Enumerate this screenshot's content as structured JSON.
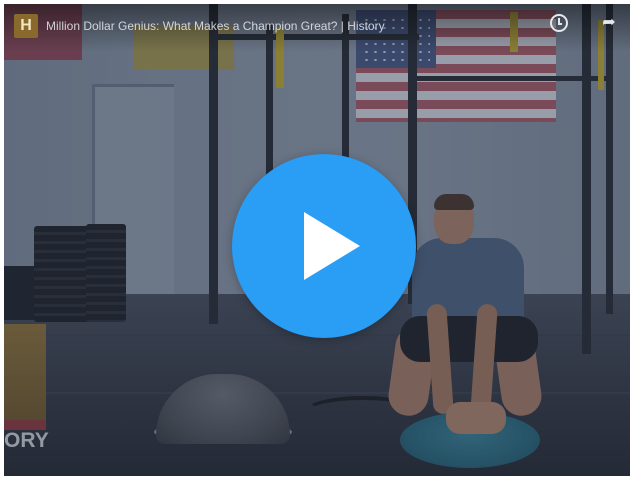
{
  "video": {
    "title": "Million Dollar Genius: What Makes a Champion Great? | History",
    "channel_logo_letter": "H",
    "brand_watermark": "ORY"
  },
  "controls": {
    "play_icon": "play-icon",
    "watch_later_icon": "clock-icon",
    "share_icon": "share-icon"
  },
  "colors": {
    "play_button": "#2a9df4",
    "play_glyph": "#ffffff"
  }
}
